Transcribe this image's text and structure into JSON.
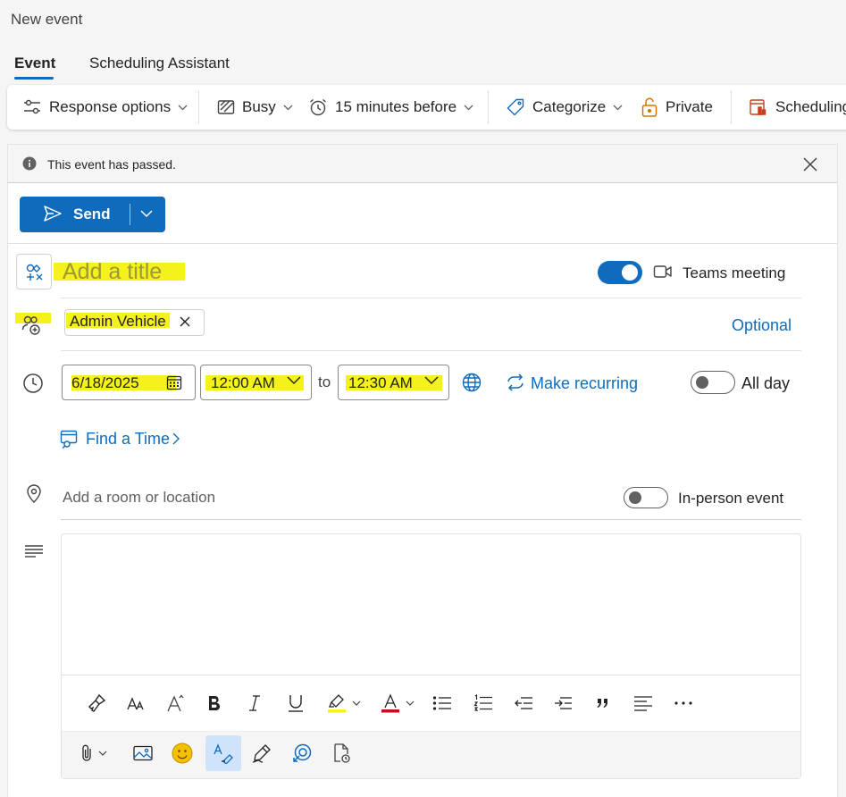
{
  "window": {
    "title": "New event"
  },
  "tabs": [
    {
      "label": "Event"
    },
    {
      "label": "Scheduling Assistant"
    }
  ],
  "ribbon": {
    "response_options": "Response options",
    "show_as": "Busy",
    "reminder": "15 minutes before",
    "categorize": "Categorize",
    "private": "Private",
    "scheduling": "Scheduling"
  },
  "notice": {
    "text": "This event has passed."
  },
  "send": {
    "label": "Send"
  },
  "title": {
    "placeholder": "Add a title"
  },
  "teams": {
    "label": "Teams meeting",
    "enabled": true
  },
  "attendees": {
    "chips": [
      {
        "name": "Admin Vehicle"
      }
    ],
    "optional_label": "Optional"
  },
  "datetime": {
    "date": "6/18/2025",
    "start": "12:00 AM",
    "to_label": "to",
    "end": "12:30 AM",
    "recurring_label": "Make recurring",
    "all_day_label": "All day",
    "all_day": false
  },
  "find_time": {
    "label": "Find a Time"
  },
  "location": {
    "placeholder": "Add a room or location",
    "in_person_label": "In-person event",
    "in_person": false
  },
  "colors": {
    "accent": "#0f6cbd",
    "highlight": "#f4f11b",
    "font_color_underline": "#c50f1f"
  }
}
